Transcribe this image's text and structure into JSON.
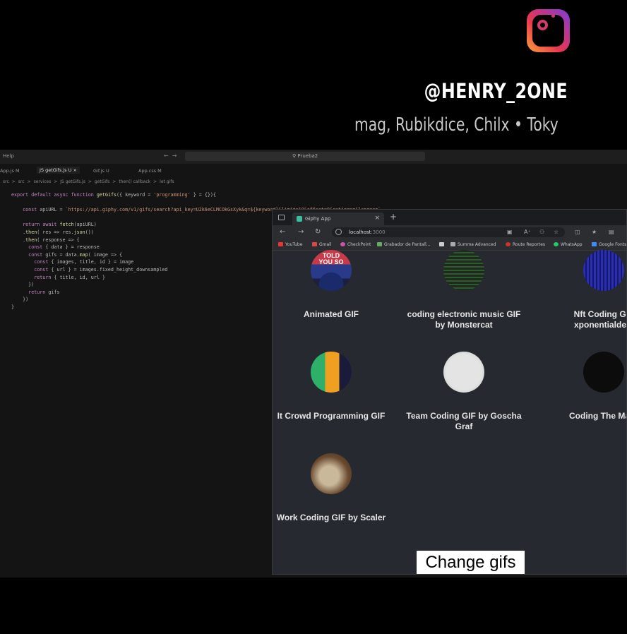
{
  "overlay": {
    "instagram_icon": "instagram-logo",
    "handle": "@HENRY_2ONE",
    "credits": "mag, Rubikdice, Chilx • Toky"
  },
  "editor": {
    "menu": "Help",
    "command_center": "Prueba2",
    "tabs": [
      {
        "label": "App.js M"
      },
      {
        "label": "JS getGifs.js U ×"
      },
      {
        "label": "Gif.js U"
      },
      {
        "label": "App.css M"
      }
    ],
    "breadcrumb": [
      "src",
      ">",
      "src",
      ">",
      "services",
      ">",
      "JS getGifs.js",
      ">",
      "getGifs",
      ">",
      "then() callback",
      ">",
      "let gifs"
    ],
    "code_lines": [
      "export default async function getGifs({ keyword = 'programming' } = {}){",
      "",
      "    const apiURL = `https://api.giphy.com/v1/gifs/search?api_key=U2k6eCLMCOkGsXyk&q=${keyword}&limit=10&offset=0&rating=g&lang=en`",
      "",
      "    return await fetch(apiURL)",
      "    .then( res => res.json())",
      "    .then( response => {",
      "      const { data } = response",
      "      const gifs = data.map( image => {",
      "        const { images, title, id } = image",
      "        const { url } = images.fixed_height_downsampled",
      "        return { title, id, url }",
      "      })",
      "      return gifs",
      "    })",
      "}"
    ]
  },
  "browser": {
    "tab_title": "Giphy App",
    "url_host": "localhost",
    "url_port": ":3000",
    "bookmarks": [
      "YouTube",
      "Gmail",
      "CheckPoint",
      "Grabador de Pantall...",
      "",
      "Summa Advanced",
      "Route Reportes",
      "WhatsApp",
      "Google Fonts"
    ],
    "gifs": [
      {
        "title": "Animated GIF",
        "thumb": "told-you-so"
      },
      {
        "title": "coding electronic music GIF by Monstercat",
        "thumb": "green-code"
      },
      {
        "title": "Nft Coding GIF xponentialdesi",
        "thumb": "blue-grid"
      },
      {
        "title": "It Crowd Programming GIF",
        "thumb": "it-crowd"
      },
      {
        "title": "Team Coding GIF by Goscha Graf",
        "thumb": "sketch"
      },
      {
        "title": "Coding The Matri",
        "thumb": "matrix-dark"
      },
      {
        "title": "Work Coding GIF by Scaler",
        "thumb": "scaler"
      }
    ],
    "change_button": "Change gifs"
  }
}
